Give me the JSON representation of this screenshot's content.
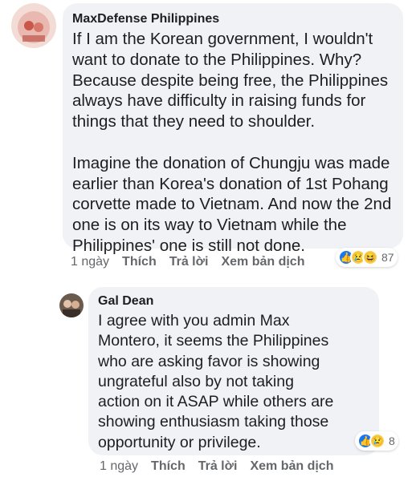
{
  "comments": [
    {
      "author": "MaxDefense Philippines",
      "avatar_label": "MAXDEFENSE",
      "text": "If I am the Korean government, I wouldn't\nwant to donate to the Philippines. Why?\nBecause despite being free, the Philippines\nalways have difficulty in raising funds for\nthings that they need to shoulder.\n\nImagine the donation of Chungju was made\nearlier than Korea's donation of 1st Pohang\ncorvette made to Vietnam. And now the 2nd\none is on its way to Vietnam while the\nPhilippines' one is still not done.",
      "time": "1 ngày",
      "like_label": "Thích",
      "reply_label": "Trả lời",
      "translate_label": "Xem bản dịch",
      "reaction_icons": [
        "like-icon",
        "sad-icon",
        "haha-icon"
      ],
      "reaction_count": "87"
    },
    {
      "author": "Gal Dean",
      "text": "I agree with you admin Max\nMontero, it seems the Philippines\nwho are asking favor is showing\nungrateful also by not taking\naction on it ASAP while others are\nshowing enthusiasm taking those\nopportunity or privilege.",
      "time": "1 ngày",
      "like_label": "Thích",
      "reply_label": "Trả lời",
      "translate_label": "Xem bản dịch",
      "reaction_icons": [
        "like-icon",
        "sad-icon"
      ],
      "reaction_count": "8"
    }
  ],
  "colors": {
    "bubble_bg": "#f0f2f5",
    "meta_text": "#65676b",
    "like_blue": "#1877f2",
    "emoji_yellow": "#f7d15b"
  }
}
